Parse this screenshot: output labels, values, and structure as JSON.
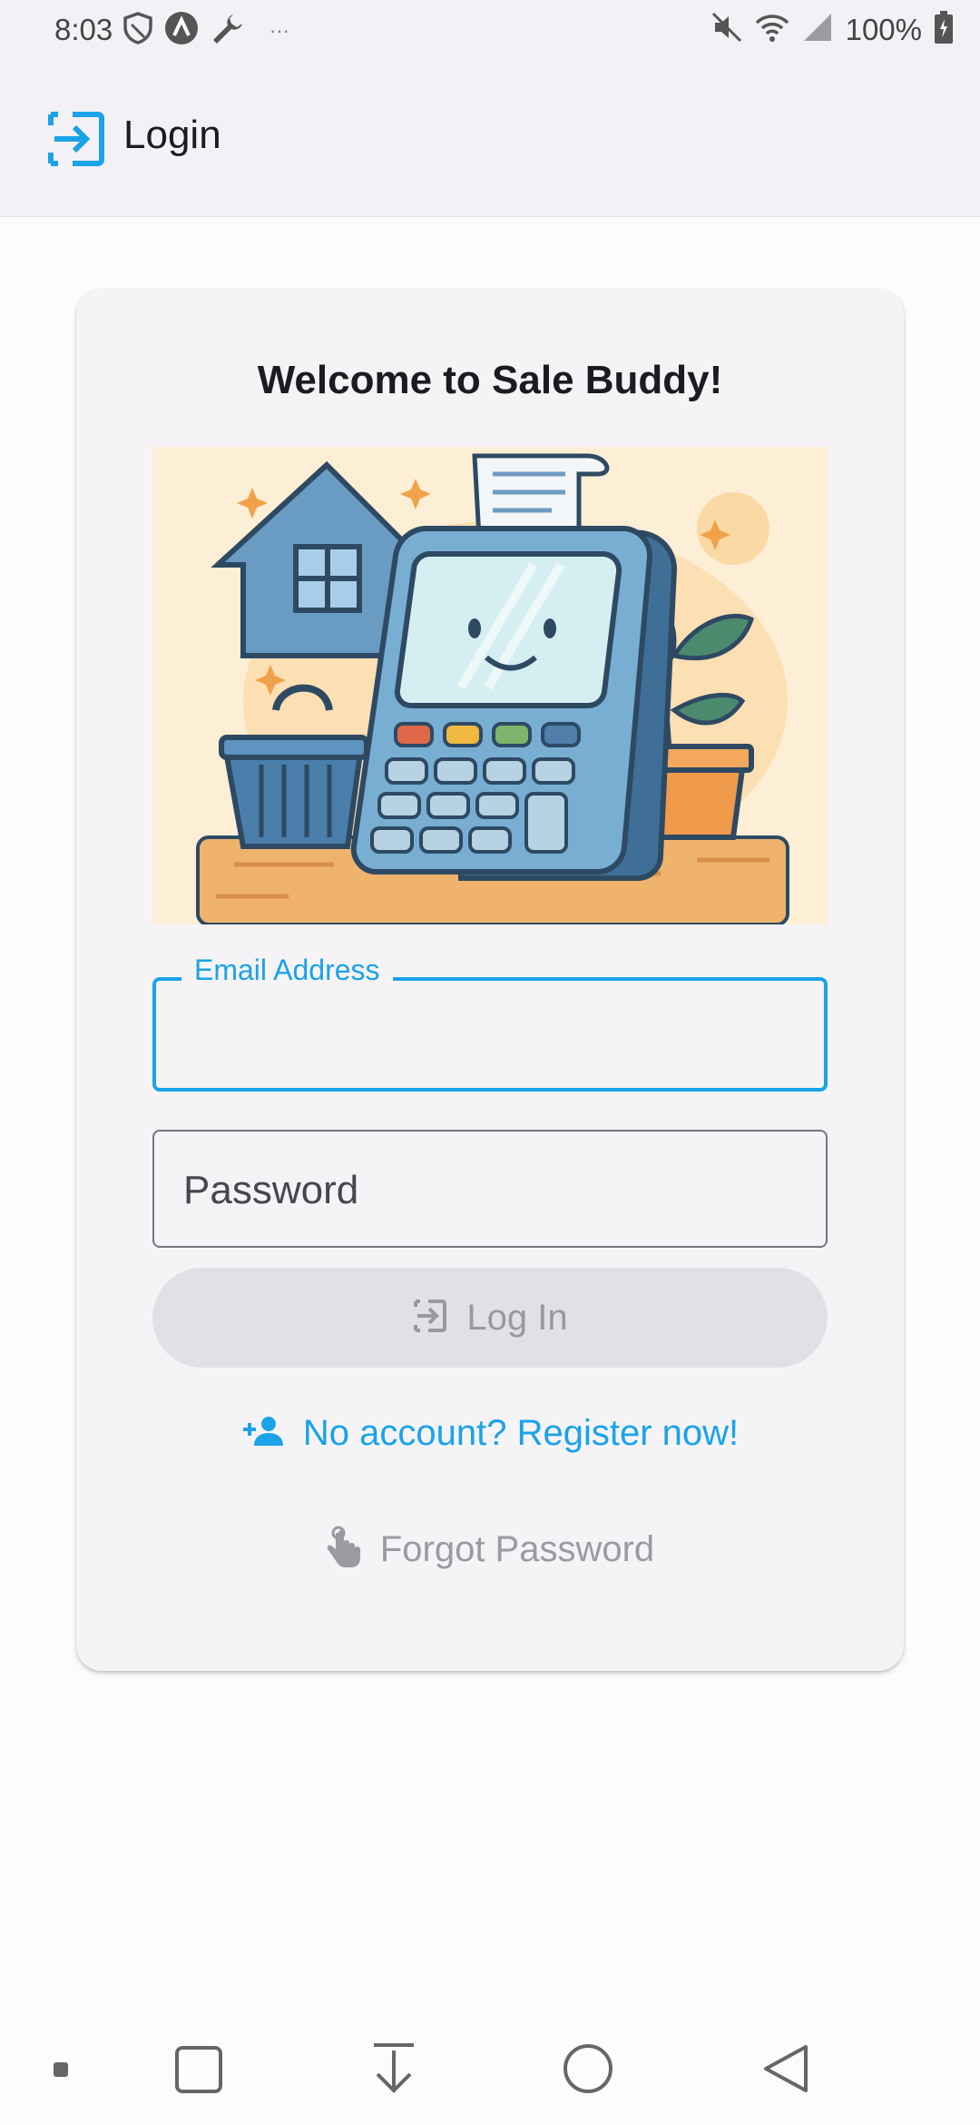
{
  "status_bar": {
    "time": "8:03",
    "overflow": "···",
    "battery_percent": "100%",
    "icons_left": [
      "shield-icon",
      "vpn-icon",
      "wrench-icon"
    ],
    "icons_right": [
      "mute-icon",
      "wifi-icon",
      "signal-icon",
      "battery-icon"
    ]
  },
  "app_bar": {
    "title": "Login",
    "icon": "login-icon"
  },
  "card": {
    "welcome": "Welcome to Sale Buddy!",
    "illustration": "cash-register-illustration"
  },
  "form": {
    "email": {
      "label": "Email Address",
      "value": "",
      "state": "focused"
    },
    "password": {
      "placeholder": "Password",
      "value": ""
    },
    "login_button": {
      "label": "Log In",
      "enabled": false,
      "icon": "login-icon"
    },
    "register_link": {
      "label": "No account? Register now!",
      "icon": "add-user-icon"
    },
    "forgot_link": {
      "label": "Forgot Password",
      "icon": "touch-icon"
    }
  },
  "nav_bar": {
    "buttons": [
      "dot",
      "recents",
      "download",
      "home",
      "back"
    ]
  },
  "colors": {
    "accent": "#1aa3e8",
    "background": "#fefbff",
    "card": "#f6f3f7",
    "app_bar": "#f3f1f5",
    "disabled_button": "#e2e0e5",
    "disabled_text": "#9a989f"
  }
}
